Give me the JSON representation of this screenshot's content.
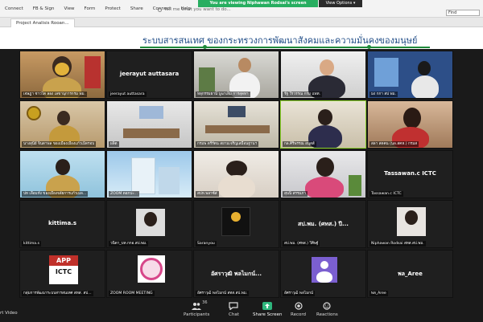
{
  "ribbon": {
    "menu": [
      "Connect",
      "FB & Sign",
      "View",
      "Form",
      "Protect",
      "Share",
      "Connect",
      "Help"
    ],
    "search_text": "Tell me what you want to do...",
    "find_label": "Find"
  },
  "share_banner": "You are viewing Niphawan Rodsai's screen",
  "view_options_label": "View Options ▾",
  "doc_tab_label": "Project Analisis Rooan...",
  "slide_title": "ระบบสารสนเทศ  ของกระทรวงการพัฒนาสังคมและความมั่นคงของมนุษย์",
  "tiles": [
    {
      "label": "เจษฎา ชาวไต ลอง เลขานุการกรม พม.",
      "type": "video"
    },
    {
      "label": "jeerayut auttasara",
      "name": "jeerayut auttasara",
      "type": "name"
    },
    {
      "label": "หลุกรรมธาน์ บูฆาเลิม การสุดทา",
      "type": "video"
    },
    {
      "label": "รัฐ วีรวรรณ กรม แพท.",
      "type": "video"
    },
    {
      "label": "มง กกา สป พม.",
      "type": "video"
    },
    {
      "label": "นางสุนีย์ จินดาพล ของเมืองเมืองแก้วเม็ดรอบ",
      "type": "video"
    },
    {
      "label": "ผลิต",
      "type": "video"
    },
    {
      "label": "กรมพ ตรีรัตน สยามเจริญเสมือนฐานฯ",
      "type": "video"
    },
    {
      "label": "กล.ศิริพรรณ อนุสส์",
      "type": "video"
    },
    {
      "label": "สลา สดคน (นล.สคห.) กรมส",
      "type": "video"
    },
    {
      "label": "ปท เลือมหัง ของเมืองจลัยการแก้วเมล...",
      "type": "video"
    },
    {
      "label": "ZOOM ดอกปะ...",
      "type": "video"
    },
    {
      "label": "สปห.พลาซ์ส่",
      "type": "video"
    },
    {
      "label": "สุนนิ่ สรรมภา",
      "type": "video"
    },
    {
      "label": "Tassawan.c ICTC",
      "name": "Tassawan.c  ICTC",
      "type": "name"
    },
    {
      "label": "kittima.s",
      "name": "kittima.s",
      "type": "name"
    },
    {
      "label": "วนิดา_บท.กกอ.สป.พม.",
      "type": "video"
    },
    {
      "label": "Saranyou",
      "type": "video"
    },
    {
      "label": "สป.พม. (ศทส.) วิศิษฐ์",
      "name": "สป.พม. (ศทส.) ปี...",
      "type": "name"
    },
    {
      "label": "Niphawan Rodsai สทส.สป.พม.",
      "type": "video"
    },
    {
      "label": "กลุ่มการพัฒนาระบบสารสนเทศ สทส. สป...",
      "type": "video"
    },
    {
      "label": "ZOOM ROOM MEETING",
      "type": "video"
    },
    {
      "label": "อัศราวุฒิ พลไมกน์ สทส.สป.พม.",
      "name": "อัศราวุฒิ พลไมกน์...",
      "type": "name"
    },
    {
      "label": "อัศราวุฒิ พลไมกน์",
      "type": "video"
    },
    {
      "label": "พล_Aree",
      "name": "พล_Aree",
      "type": "name"
    }
  ],
  "app_badge": {
    "line1": "APP",
    "line2": "ICTC"
  },
  "toolbar": {
    "participants_label": "Participants",
    "participants_count": "36",
    "chat_label": "Chat",
    "share_label": "Share Screen",
    "record_label": "Record",
    "reactions_label": "Reactions",
    "stop_video_label": "rt Video"
  },
  "colors": {
    "title_blue": "#1e4b86",
    "accent_green": "#1e8a3a",
    "share_green": "#27ae60",
    "speaking": "#8bd12a"
  }
}
